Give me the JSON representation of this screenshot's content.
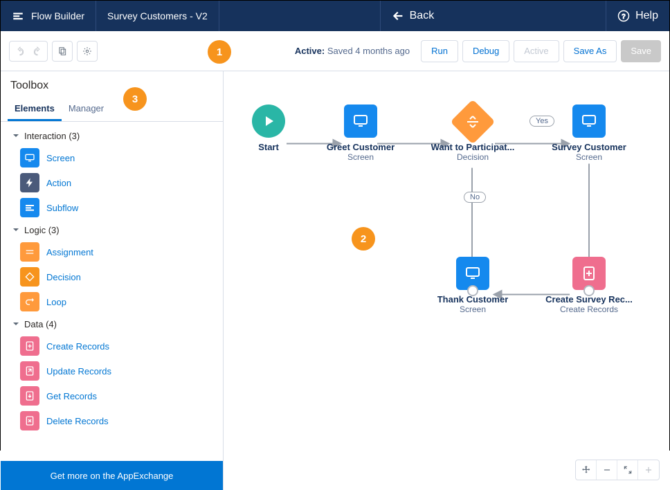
{
  "topbar": {
    "app": "Flow Builder",
    "flow": "Survey Customers - V2",
    "back": "Back",
    "help": "Help"
  },
  "buttonbar": {
    "status_label": "Active:",
    "status_value": "Saved 4 months ago",
    "run": "Run",
    "debug": "Debug",
    "active": "Active",
    "saveas": "Save As",
    "save": "Save"
  },
  "sidebar": {
    "title": "Toolbox",
    "tabs": {
      "elements": "Elements",
      "manager": "Manager"
    },
    "cats": [
      {
        "label": "Interaction (3)",
        "items": [
          {
            "label": "Screen",
            "icon": "screen",
            "cls": "ic-blue"
          },
          {
            "label": "Action",
            "icon": "bolt",
            "cls": "ic-navy"
          },
          {
            "label": "Subflow",
            "icon": "subflow",
            "cls": "ic-blue"
          }
        ]
      },
      {
        "label": "Logic (3)",
        "items": [
          {
            "label": "Assignment",
            "icon": "assign",
            "cls": "ic-orange"
          },
          {
            "label": "Decision",
            "icon": "decision",
            "cls": "ic-orange-d"
          },
          {
            "label": "Loop",
            "icon": "loop",
            "cls": "ic-orange"
          }
        ]
      },
      {
        "label": "Data (4)",
        "items": [
          {
            "label": "Create Records",
            "icon": "create",
            "cls": "ic-pink"
          },
          {
            "label": "Update Records",
            "icon": "update",
            "cls": "ic-pink"
          },
          {
            "label": "Get Records",
            "icon": "get",
            "cls": "ic-pink"
          },
          {
            "label": "Delete Records",
            "icon": "delete",
            "cls": "ic-pink"
          }
        ]
      }
    ],
    "exchange": "Get more on the AppExchange"
  },
  "callouts": {
    "c1": "1",
    "c2": "2",
    "c3": "3"
  },
  "nodes": {
    "start": {
      "title": "Start",
      "sub": ""
    },
    "greet": {
      "title": "Greet Customer",
      "sub": "Screen"
    },
    "want": {
      "title": "Want to Participat...",
      "sub": "Decision"
    },
    "survey": {
      "title": "Survey Customer",
      "sub": "Screen"
    },
    "thank": {
      "title": "Thank Customer",
      "sub": "Screen"
    },
    "create": {
      "title": "Create Survey Rec...",
      "sub": "Create Records"
    }
  },
  "edge_labels": {
    "yes": "Yes",
    "no": "No"
  }
}
